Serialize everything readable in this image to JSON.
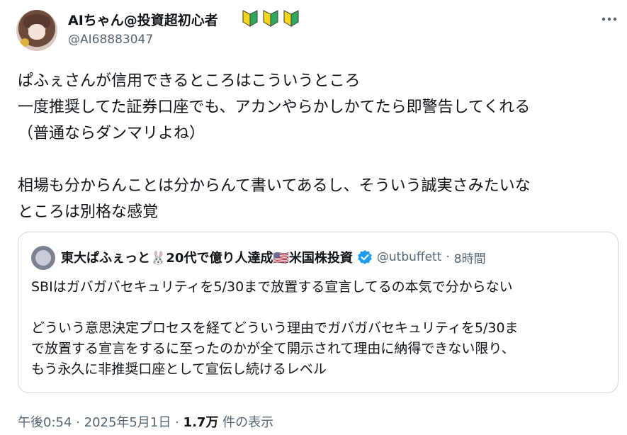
{
  "author": {
    "display_name": "AIちゃん@投資超初心者",
    "badges": [
      "beginner-mark-icon",
      "beginner-mark-icon",
      "beginner-mark-icon"
    ],
    "handle": "@AI68883047"
  },
  "tweet": {
    "lines": [
      "ぱふぇさんが信用できるところはこういうところ",
      "一度推奨してた証券口座でも、アカンやらかしかてたら即警告してくれる",
      "（普通ならダンマリよね）",
      "",
      "相場も分からんことは分からんて書いてあるし、そういう誠実さみたいな",
      "ところは別格な感覚"
    ]
  },
  "quoted": {
    "display_name": "東大ぱふぇっと🐰20代で億り人達成🇺🇸米国株投資",
    "handle": "@utbuffett",
    "separator": "·",
    "time": "8時間",
    "lines": [
      "SBIはガバガバセキュリティを5/30まで放置する宣言してるの本気で分からない",
      "",
      "どういう意思決定プロセスを経てどういう理由でガバガバセキュリティを5/30ま",
      "で放置する宣言をするに至ったのかが全て開示されて理由に納得できない限り、",
      "もう永久に非推奨口座として宣伝し続けるレベル"
    ]
  },
  "meta": {
    "time": "午後0:54",
    "separator": "·",
    "date": "2025年5月1日",
    "views": "1.7万",
    "views_label": "件の表示"
  },
  "colors": {
    "text": "#0f1419",
    "secondary": "#536471",
    "border": "#cfd9de",
    "verified": "#1d9bf0",
    "beginner_green": "#2eaa5c",
    "beginner_yellow": "#f3d51b"
  }
}
